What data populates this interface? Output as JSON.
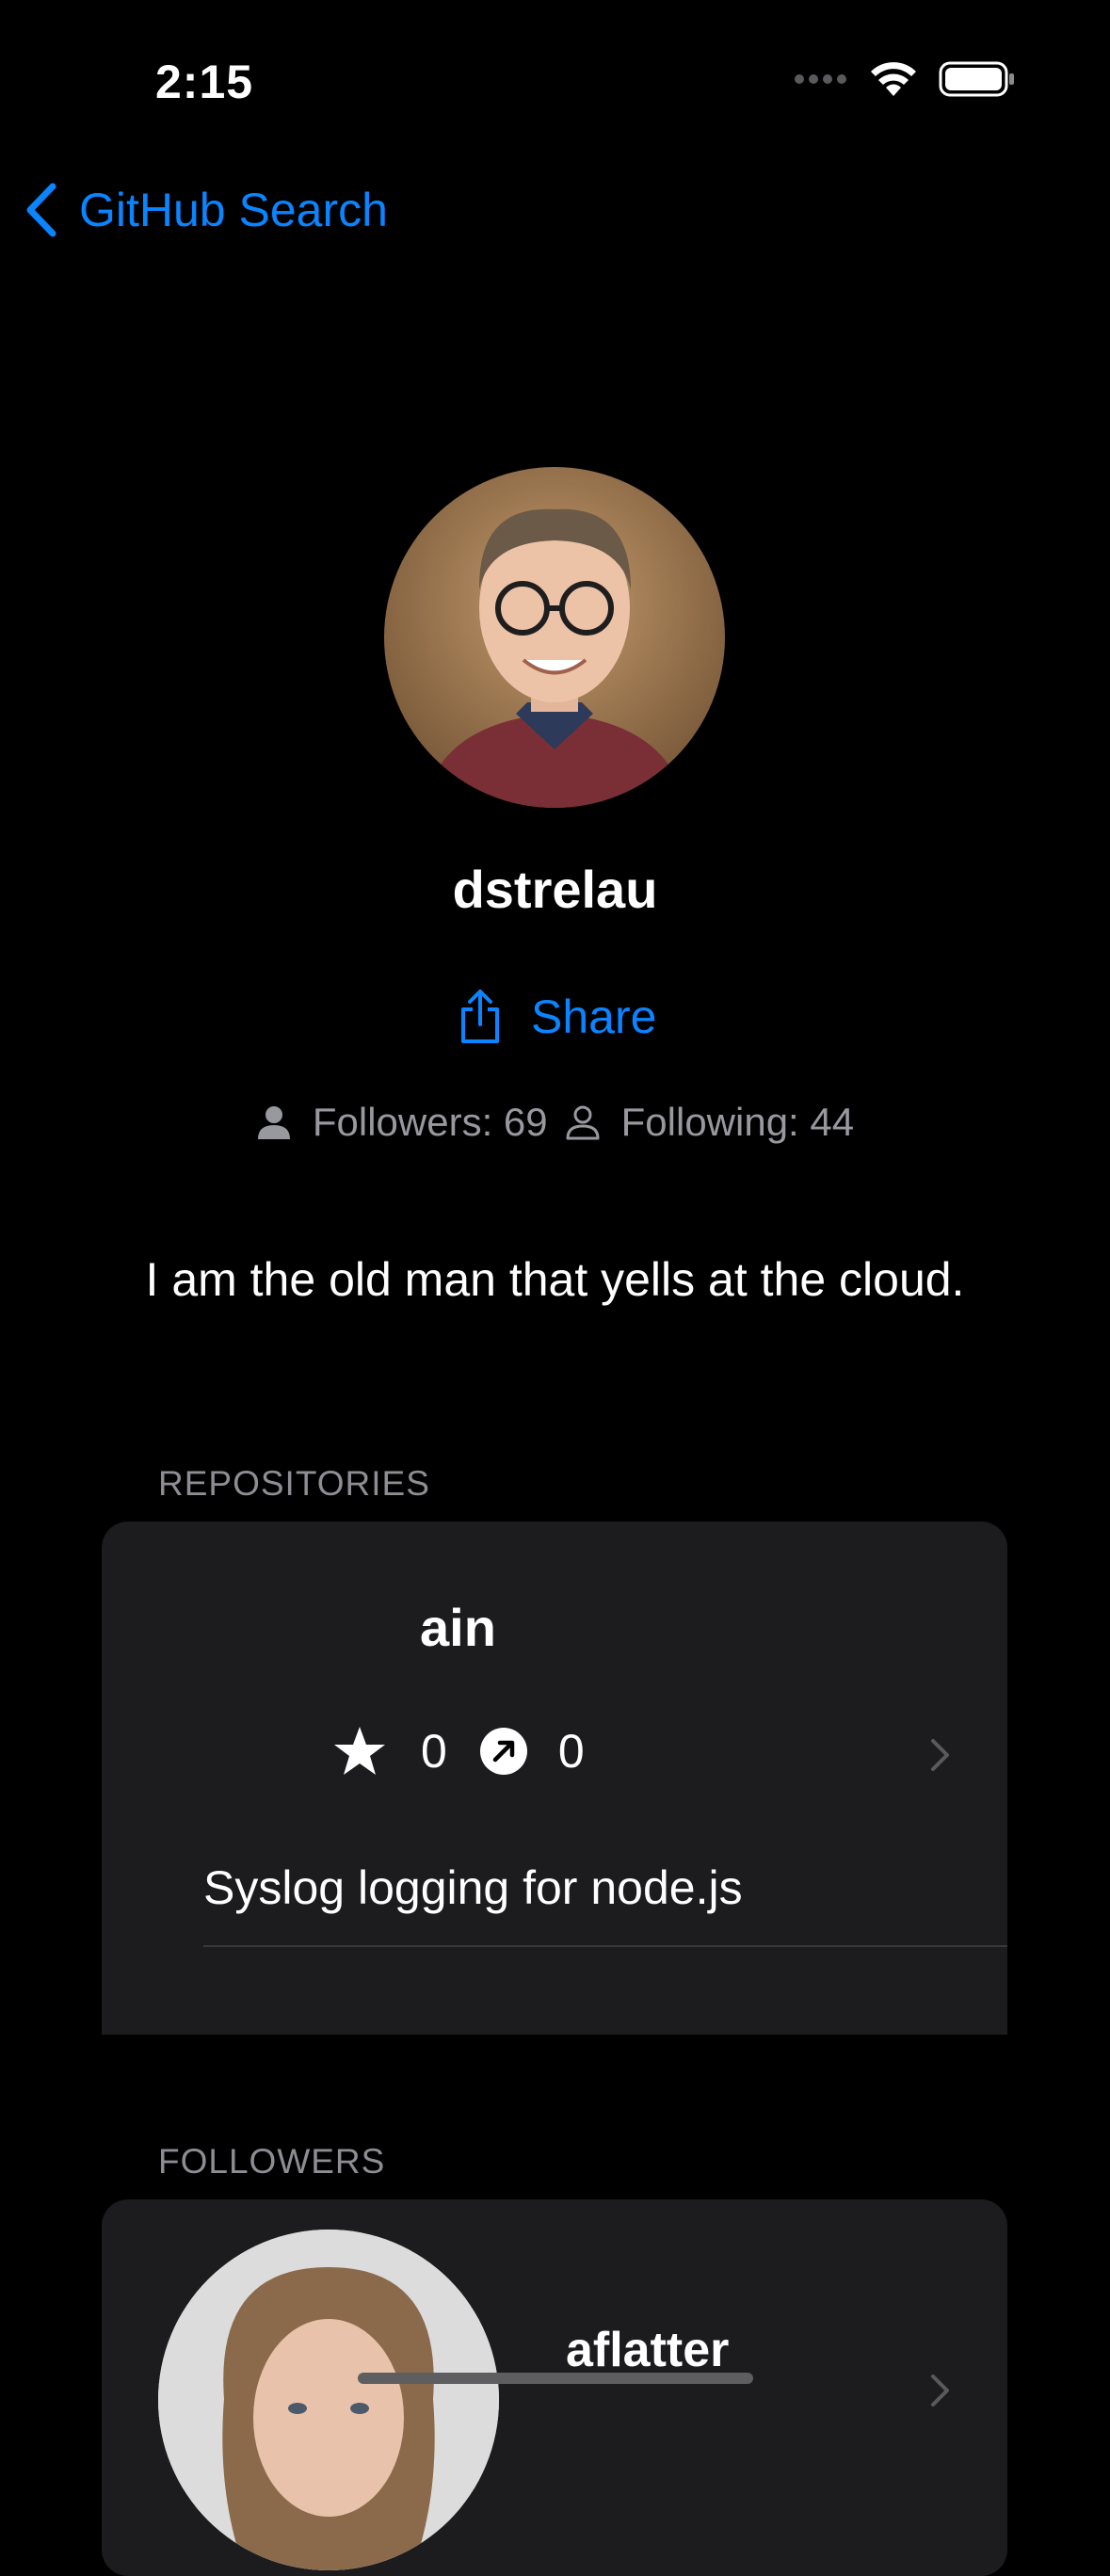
{
  "status_bar": {
    "time": "2:15"
  },
  "nav": {
    "back_label": "GitHub Search"
  },
  "profile": {
    "username": "dstrelau",
    "share_label": "Share",
    "followers": "Followers: 69",
    "following": "Following: 44",
    "bio": "I am the old man that yells at the cloud."
  },
  "repositories": {
    "header": "REPOSITORIES",
    "items": [
      {
        "name": "ain",
        "stars": "0",
        "forks": "0",
        "description": "Syslog logging for node.js"
      }
    ]
  },
  "followers_section": {
    "header": "FOLLOWERS",
    "items": [
      {
        "login": "aflatter"
      }
    ]
  },
  "colors": {
    "accent": "#0a84ff",
    "background": "#000000",
    "card": "#1c1c1e",
    "secondary_text": "#98989f"
  }
}
